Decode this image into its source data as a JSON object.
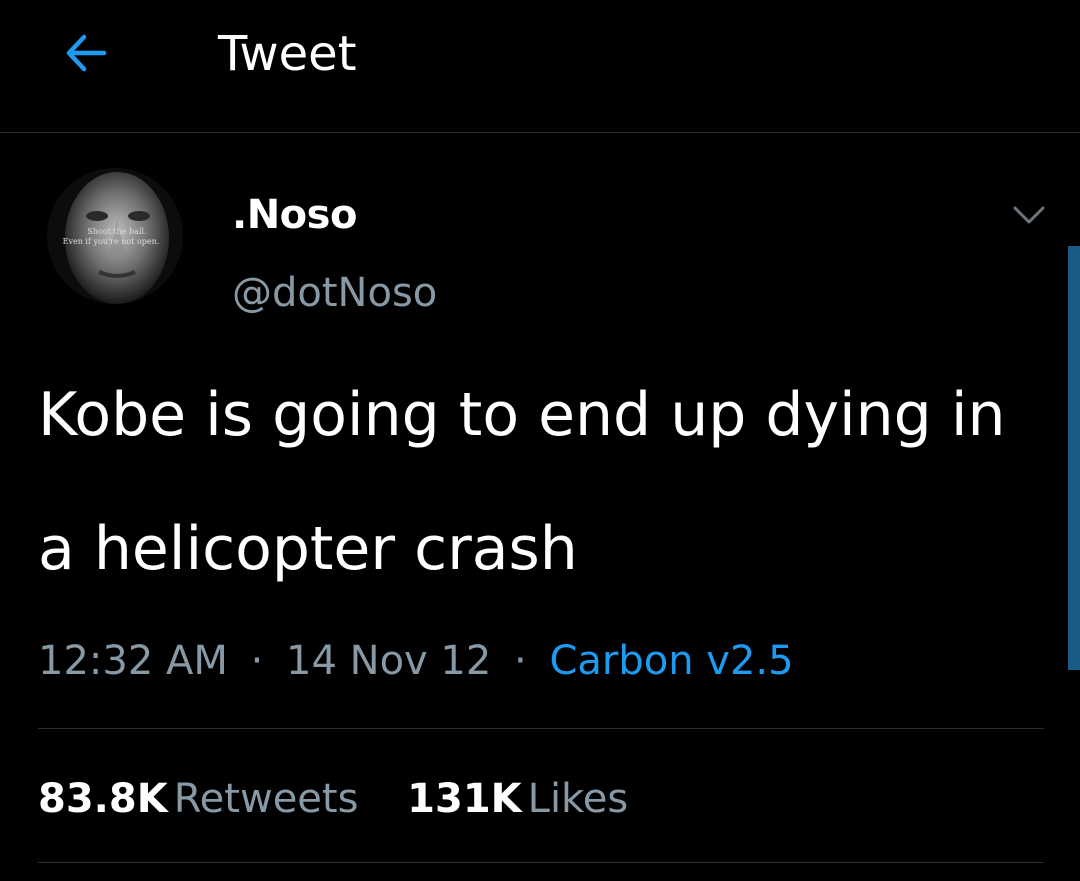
{
  "header": {
    "back_icon": "arrow-left-icon",
    "title": "Tweet",
    "accent_color": "#1d9bf0"
  },
  "tweet": {
    "author": {
      "display_name": ".Noso",
      "handle": "@dotNoso",
      "avatar_text_line1": "Shoot the ball.",
      "avatar_text_line2": "Even if you're not open."
    },
    "menu_icon": "chevron-down-icon",
    "text": "Kobe is going to end up dying in a helicopter crash",
    "time": "12:32 AM",
    "date": "14 Nov 12",
    "separator": "·",
    "source": "Carbon v2.5",
    "stats": {
      "retweets_count": "83.8K",
      "retweets_label": "Retweets",
      "likes_count": "131K",
      "likes_label": "Likes"
    }
  }
}
